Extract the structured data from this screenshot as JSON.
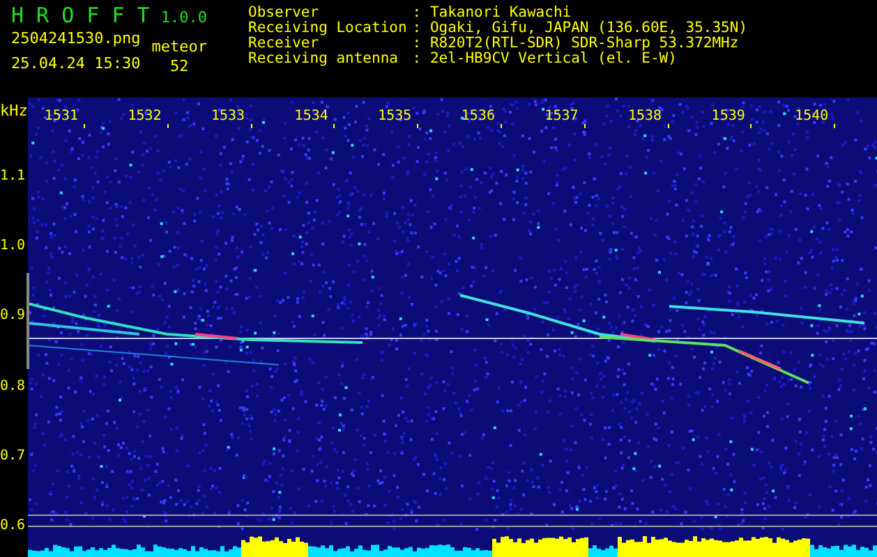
{
  "app": {
    "name": "H R O F F T",
    "version": "1.0.0"
  },
  "file": {
    "name": "2504241530.png",
    "datetime": "25.04.24 15:30"
  },
  "meteor": {
    "label": "meteor",
    "count": "52"
  },
  "info": [
    {
      "label": "Observer",
      "value": ": Takanori Kawachi"
    },
    {
      "label": "Receiving Location",
      "value": ": Ogaki, Gifu, JAPAN (136.60E, 35.35N)"
    },
    {
      "label": "Receiver",
      "value": ": R820T2(RTL-SDR) SDR-Sharp 53.372MHz"
    },
    {
      "label": "Receiving antenna",
      "value": ": 2el-HB9CV Vertical (el. E-W)"
    }
  ],
  "axis": {
    "unit": "kHz",
    "x_labels": [
      "1531",
      "1532",
      "1533",
      "1534",
      "1535",
      "1536",
      "1537",
      "1538",
      "1539",
      "1540"
    ],
    "y_labels": [
      "1.1",
      "1.0",
      "0.9",
      "0.8",
      "0.7",
      "0.6"
    ]
  }
}
